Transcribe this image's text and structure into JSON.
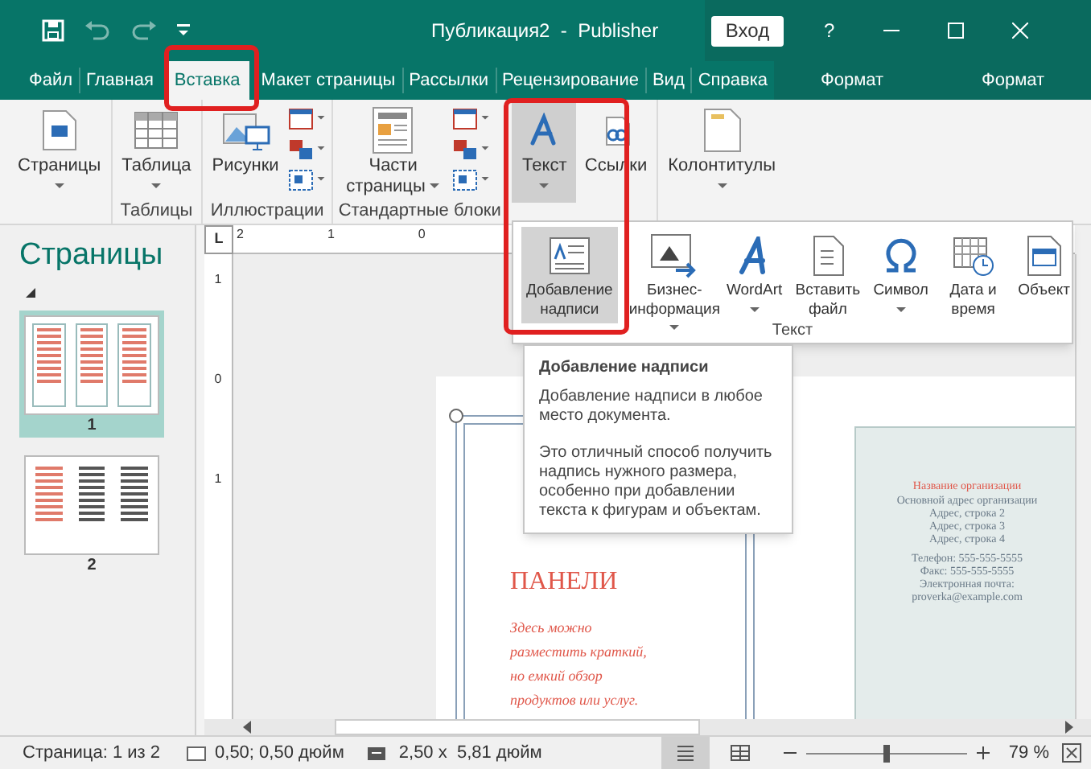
{
  "title_bar": {
    "title": "Публикация2  -  Publisher",
    "sign_in": "Вход",
    "help": "?"
  },
  "tabs": [
    {
      "label": "Файл",
      "selected": false
    },
    {
      "label": "Главная",
      "selected": false
    },
    {
      "label": "Вставка",
      "selected": true
    },
    {
      "label": "Макет страницы",
      "selected": false
    },
    {
      "label": "Рассылки",
      "selected": false
    },
    {
      "label": "Рецензирование",
      "selected": false
    },
    {
      "label": "Вид",
      "selected": false
    },
    {
      "label": "Справка",
      "selected": false
    }
  ],
  "context_tabs": [
    "Формат",
    "Формат"
  ],
  "ribbon": {
    "groups": [
      {
        "kind": "large",
        "buttons": [
          {
            "label": "Страницы",
            "kind": "dropdown",
            "pressed": false
          }
        ]
      },
      {
        "kind": "large",
        "label": "Таблицы",
        "buttons": [
          {
            "label": "Таблица",
            "kind": "dropdown",
            "pressed": false
          }
        ]
      },
      {
        "kind": "mixed",
        "label": "Иллюстрации",
        "buttons": [
          {
            "label": "Рисунки",
            "kind": "plain",
            "pressed": false
          }
        ]
      },
      {
        "kind": "mixed",
        "label": "Стандартные блоки",
        "buttons": [
          {
            "label": "Части страницы",
            "kind": "split",
            "pressed": false
          }
        ]
      },
      {
        "kind": "large",
        "buttons": [
          {
            "label": "Текст",
            "kind": "dropdown",
            "pressed": true
          },
          {
            "label": "Ссылки",
            "kind": "plain",
            "pressed": false
          }
        ]
      },
      {
        "kind": "large",
        "buttons": [
          {
            "label": "Колонтитулы",
            "kind": "dropdown",
            "pressed": false
          }
        ]
      }
    ]
  },
  "text_menu": {
    "label": "Текст",
    "items": [
      {
        "label": "Добавление надписи",
        "kind": "plain",
        "selected": true
      },
      {
        "label": "Бизнес-информация",
        "kind": "split",
        "selected": false
      },
      {
        "label": "WordArt",
        "kind": "dropdown",
        "selected": false
      },
      {
        "label": "Вставить файл",
        "kind": "plain",
        "selected": false
      },
      {
        "label": "Символ",
        "kind": "dropdown",
        "selected": false
      },
      {
        "label": "Дата и время",
        "kind": "plain",
        "selected": false
      },
      {
        "label": "Объект",
        "kind": "plain",
        "selected": false
      }
    ]
  },
  "tooltip": {
    "title": "Добавление надписи",
    "paragraphs": [
      "Добавление надписи в любое место документа.",
      "Это отличный способ получить надпись нужного размера, особенно при добавлении текста к фигурам и объектам."
    ]
  },
  "pages_pane": {
    "title": "Страницы",
    "pages": [
      {
        "label": "1",
        "selected": true
      },
      {
        "label": "2",
        "selected": false
      }
    ]
  },
  "rulers": {
    "corner": "L",
    "horizontal": [
      "2",
      "1",
      "0"
    ],
    "vertical": [
      "1",
      "0",
      "1"
    ]
  },
  "document": {
    "heading": "ПАНЕЛИ",
    "body": [
      "Здесь можно",
      "разместить краткий,",
      "но емкий обзор",
      "продуктов или услуг."
    ],
    "contact": {
      "organization": "Название организации",
      "lines": [
        "Основной адрес организации",
        "Адрес, строка 2",
        "Адрес, строка 3",
        "Адрес, строка 4"
      ],
      "contacts": [
        "Телефон: 555-555-5555",
        "Факс: 555-555-5555",
        "Электронная почта:",
        "proverka@example.com"
      ]
    }
  },
  "status_bar": {
    "page": "Страница: 1 из 2",
    "position": "0,50; 0,50 дюйм",
    "size": "2,50 x  5,81 дюйм",
    "zoom": {
      "level": 0.5,
      "reading": "79 %"
    }
  }
}
